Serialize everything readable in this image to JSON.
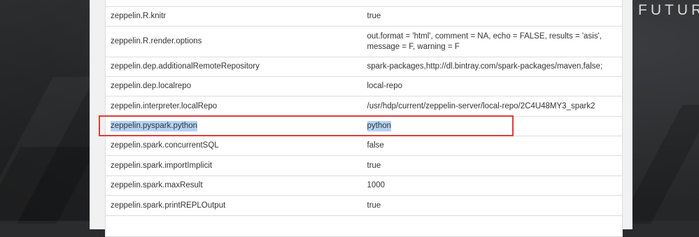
{
  "brand": {
    "visible_text": "FUTUR"
  },
  "properties": [
    {
      "name": "zeppelin.R.knitr",
      "value": "true"
    },
    {
      "name": "zeppelin.R.render.options",
      "value": "out.format = 'html', comment = NA, echo = FALSE, results = 'asis', message = F, warning = F"
    },
    {
      "name": "zeppelin.dep.additionalRemoteRepository",
      "value": "spark-packages,http://dl.bintray.com/spark-packages/maven,false;"
    },
    {
      "name": "zeppelin.dep.localrepo",
      "value": "local-repo"
    },
    {
      "name": "zeppelin.interpreter.localRepo",
      "value": "/usr/hdp/current/zeppelin-server/local-repo/2C4U48MY3_spark2"
    },
    {
      "name": "zeppelin.pyspark.python",
      "value": "python"
    },
    {
      "name": "zeppelin.spark.concurrentSQL",
      "value": "false"
    },
    {
      "name": "zeppelin.spark.importImplicit",
      "value": "true"
    },
    {
      "name": "zeppelin.spark.maxResult",
      "value": "1000"
    },
    {
      "name": "zeppelin.spark.printREPLOutput",
      "value": "true"
    }
  ],
  "colors": {
    "highlight_box": "#e33b35",
    "text_selection": "#b4d3f5"
  }
}
